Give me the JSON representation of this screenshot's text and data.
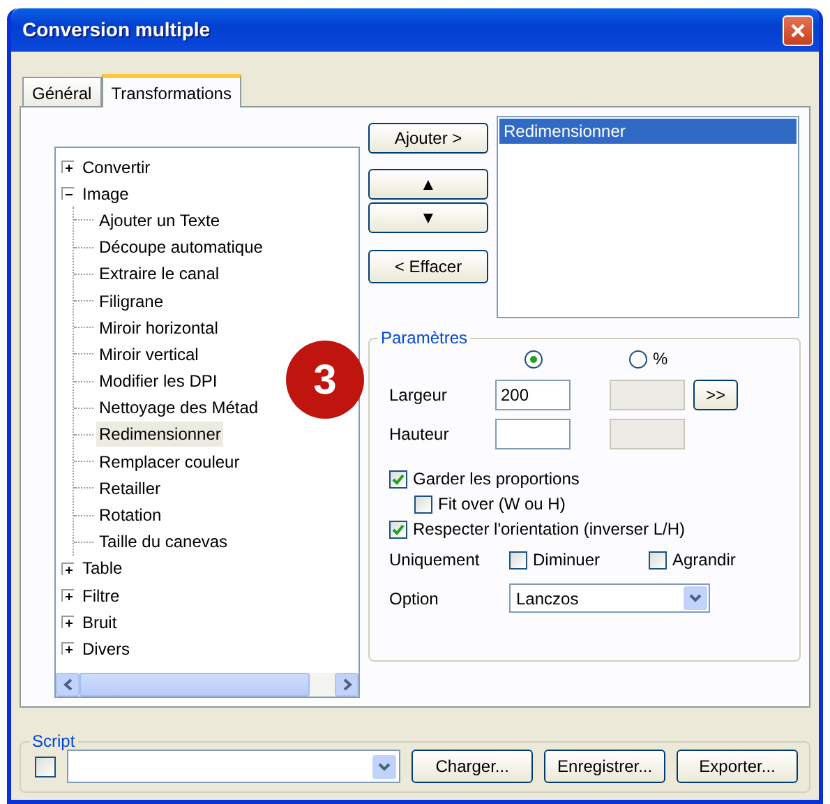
{
  "window": {
    "title": "Conversion multiple"
  },
  "tabs": [
    {
      "label": "Général",
      "selected": false
    },
    {
      "label": "Transformations",
      "selected": true
    }
  ],
  "tree": [
    {
      "label": "Convertir",
      "expanded": false
    },
    {
      "label": "Image",
      "expanded": true,
      "children": [
        {
          "label": "Ajouter un Texte",
          "selected": false
        },
        {
          "label": "Découpe automatique",
          "selected": false
        },
        {
          "label": "Extraire le canal",
          "selected": false
        },
        {
          "label": "Filigrane",
          "selected": false
        },
        {
          "label": "Miroir horizontal",
          "selected": false
        },
        {
          "label": "Miroir vertical",
          "selected": false
        },
        {
          "label": "Modifier les DPI",
          "selected": false
        },
        {
          "label": "Nettoyage des Métad",
          "selected": false
        },
        {
          "label": "Redimensionner",
          "selected": true
        },
        {
          "label": "Remplacer couleur",
          "selected": false
        },
        {
          "label": "Retailler",
          "selected": false
        },
        {
          "label": "Rotation",
          "selected": false
        },
        {
          "label": "Taille du canevas",
          "selected": false
        }
      ]
    },
    {
      "label": "Table",
      "expanded": false
    },
    {
      "label": "Filtre",
      "expanded": false
    },
    {
      "label": "Bruit",
      "expanded": false
    },
    {
      "label": "Divers",
      "expanded": false
    }
  ],
  "callout": "3",
  "actions": {
    "add": "Ajouter >",
    "up": "▲",
    "down": "▼",
    "clear": "< Effacer"
  },
  "chain": [
    {
      "label": "Redimensionner",
      "selected": true
    }
  ],
  "params": {
    "title": "Paramètres",
    "units": [
      {
        "selected": true
      },
      {
        "label": "%",
        "selected": false
      }
    ],
    "rows": [
      {
        "label": "Largeur",
        "value": "200"
      },
      {
        "label": "Hauteur"
      }
    ],
    "apply": ">>",
    "options": [
      {
        "label": "Garder les proportions",
        "checked": true,
        "children": [
          {
            "label": "Fit over (W ou H)",
            "checked": false
          }
        ]
      },
      {
        "label": "Respecter l'orientation (inverser L/H)",
        "checked": true
      }
    ],
    "only": {
      "label": "Uniquement",
      "choices": [
        {
          "label": "Diminuer",
          "checked": false
        },
        {
          "label": "Agrandir",
          "checked": false
        }
      ]
    },
    "option": {
      "label": "Option",
      "value": "Lanczos"
    }
  },
  "script": {
    "title": "Script",
    "enabled": false,
    "buttons": [
      "Charger...",
      "Enregistrer...",
      "Exporter..."
    ]
  }
}
